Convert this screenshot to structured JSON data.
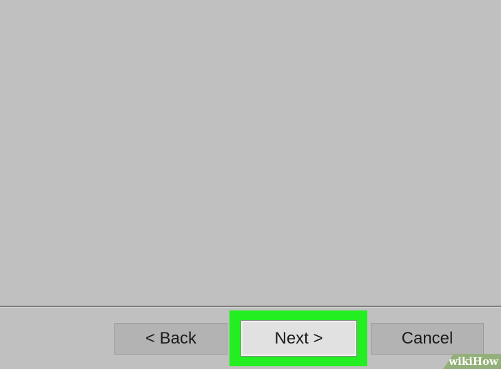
{
  "wizard": {
    "buttons": {
      "back_label": "< Back",
      "next_label": "Next >",
      "cancel_label": "Cancel"
    }
  },
  "watermark": {
    "text_part1": "wiki",
    "text_part2": "How"
  },
  "colors": {
    "background": "#c0c0c0",
    "highlight": "#22ee22",
    "button_face": "#b3b3b3",
    "focused_button_face": "#e1e1e1",
    "watermark_bg": "#93b07a"
  }
}
